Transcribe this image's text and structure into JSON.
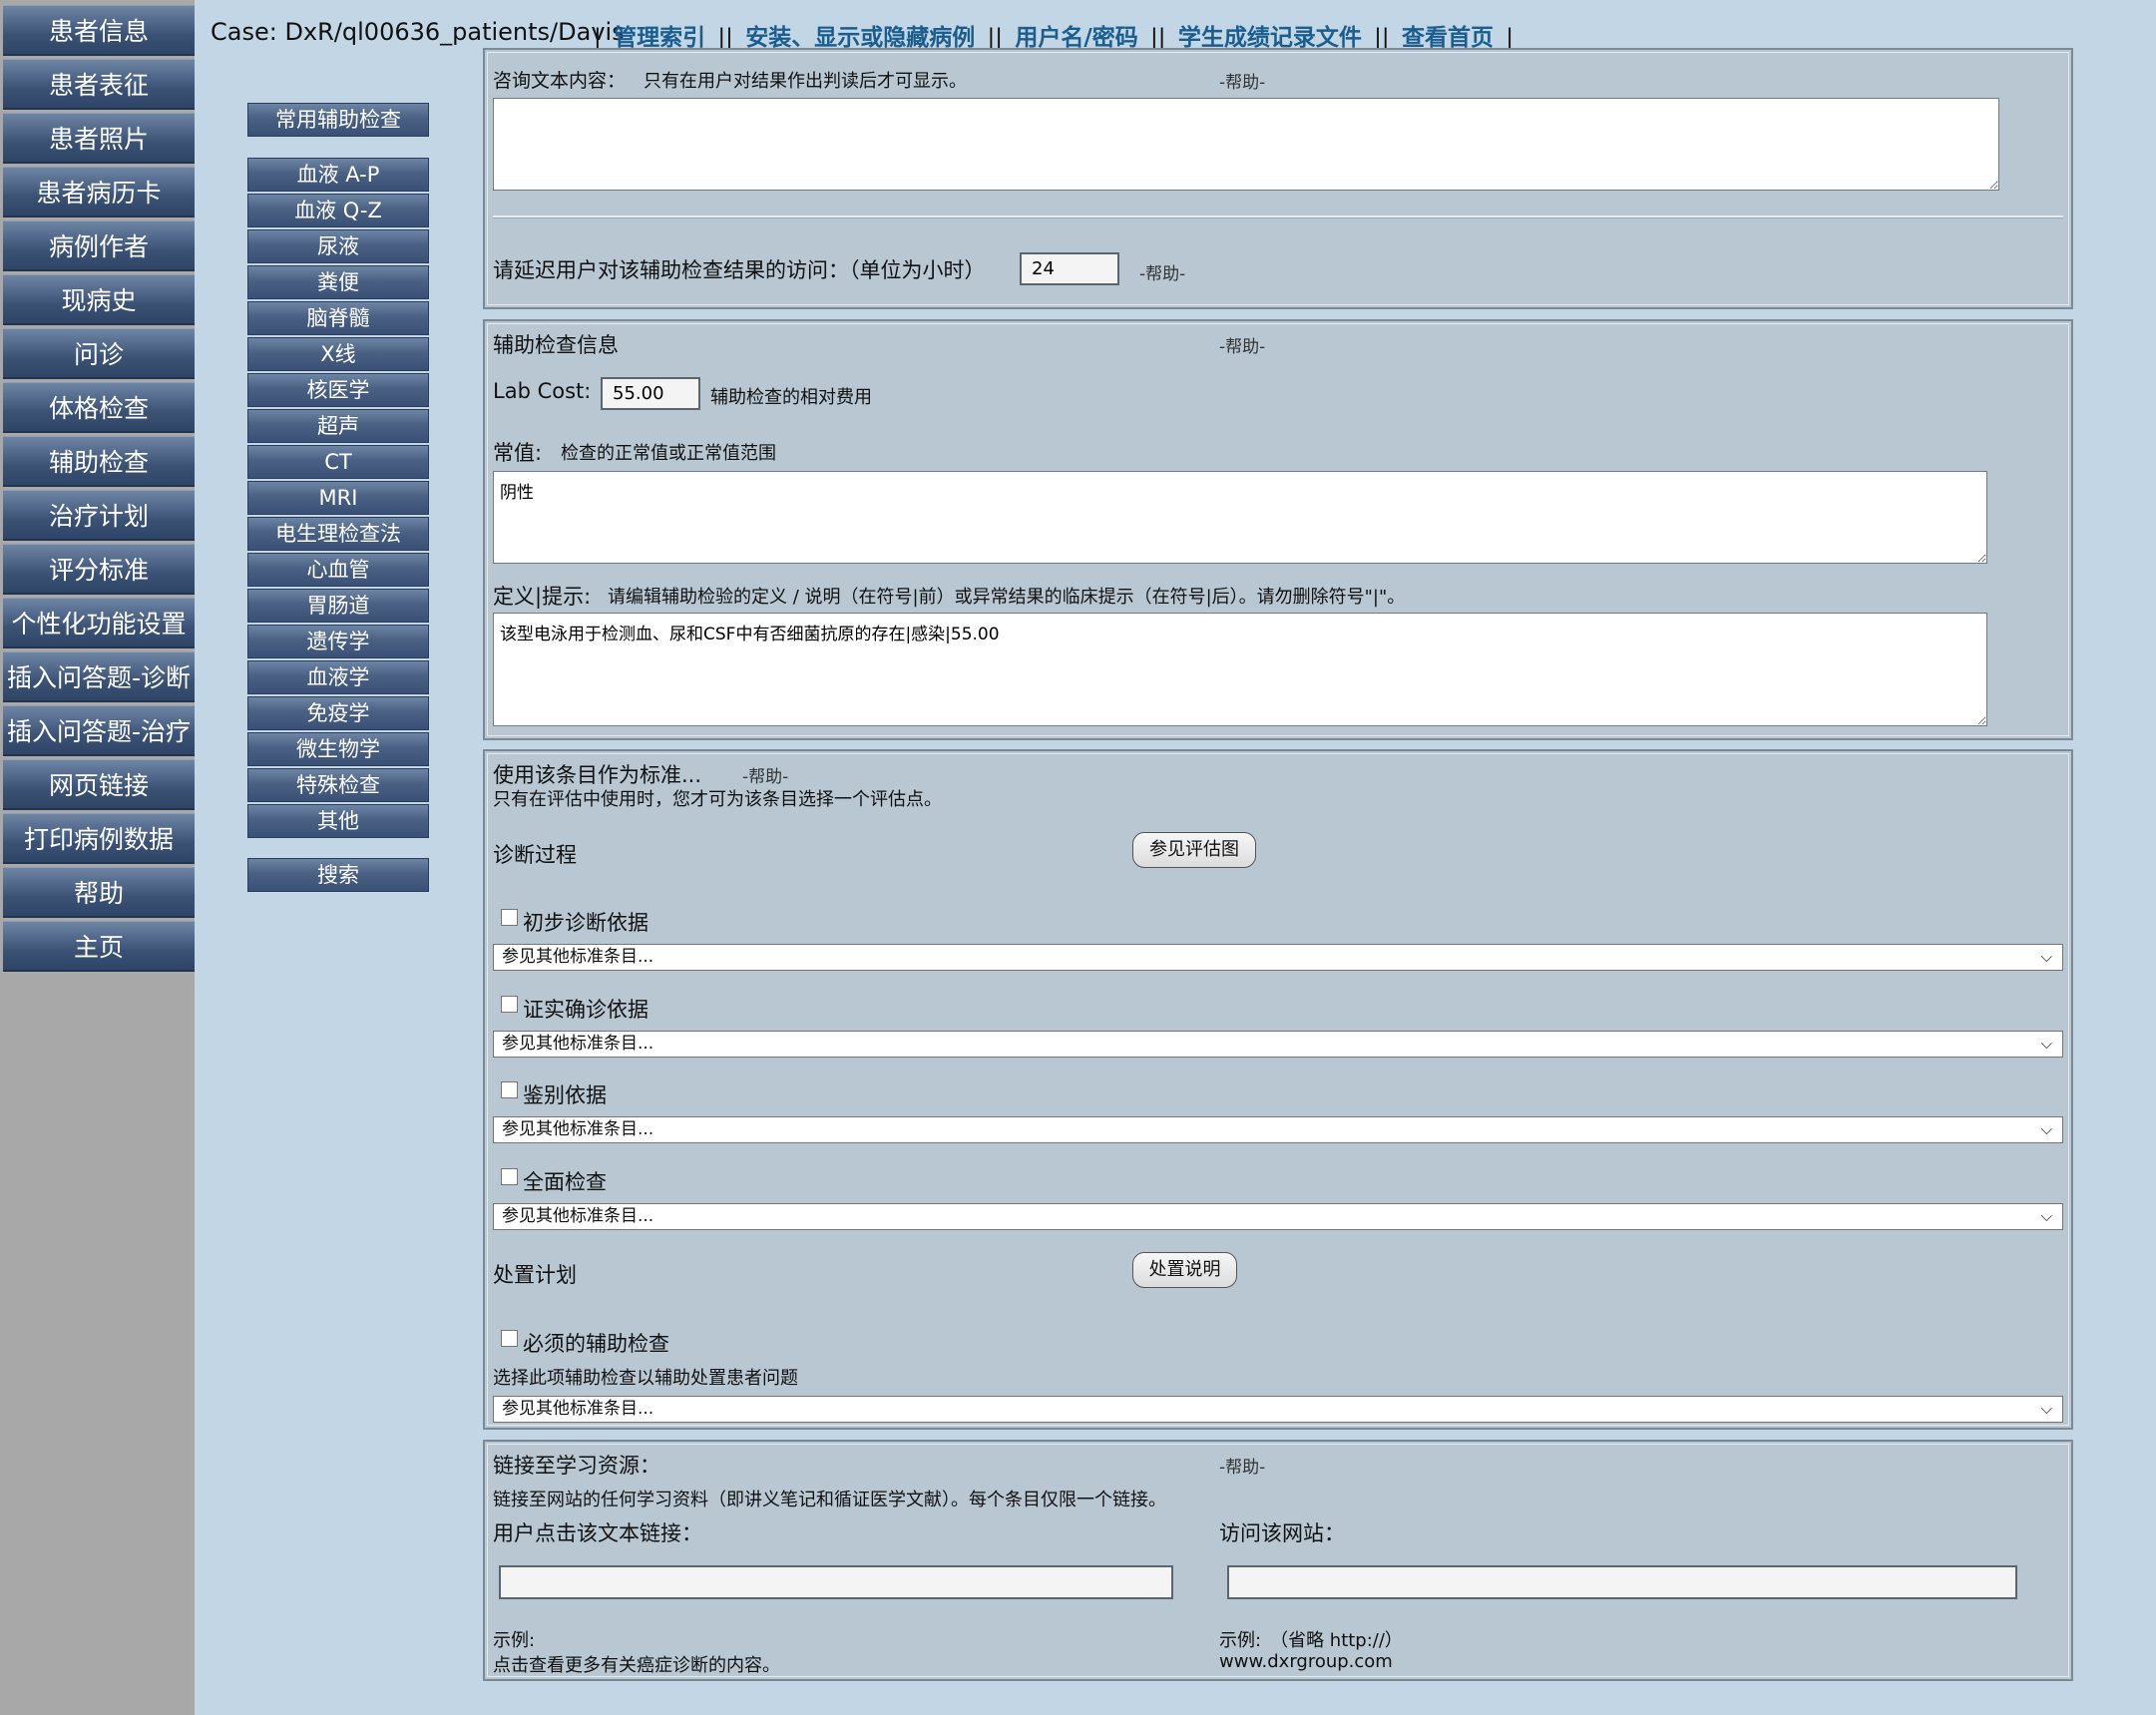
{
  "left_nav": [
    "患者信息",
    "患者表征",
    "患者照片",
    "患者病历卡",
    "病例作者",
    "现病史",
    "问诊",
    "体格检查",
    "辅助检查",
    "治疗计划",
    "评分标准",
    "个性化功能设置",
    "插入问答题-诊断",
    "插入问答题-治疗",
    "网页链接",
    "打印病例数据",
    "帮助",
    "主页"
  ],
  "header": {
    "case": "Case: DxR/ql00636_patients/Davis",
    "links": [
      "管理索引",
      "安装、显示或隐藏病例",
      "用户名/密码",
      "学生成绩记录文件",
      "查看首页"
    ],
    "sep": "||",
    "lead": "|",
    "trail": "|"
  },
  "categories": {
    "common": "常用辅助检查",
    "list": [
      "血液 A-P",
      "血液 Q-Z",
      "尿液",
      "粪便",
      "脑脊髓",
      "X线",
      "核医学",
      "超声",
      "CT",
      "MRI",
      "电生理检查法",
      "心血管",
      "胃肠道",
      "遗传学",
      "血液学",
      "免疫学",
      "微生物学",
      "特殊检查",
      "其他"
    ],
    "search": "搜索"
  },
  "help": "-帮助-",
  "consult": {
    "label": "咨询文本内容：",
    "note": "只有在用户对结果作出判读后才可显示。",
    "text": "",
    "delay_label": "请延迟用户对该辅助检查结果的访问：（单位为小时）",
    "delay_value": "24"
  },
  "lab_info": {
    "title": "辅助检查信息",
    "cost_label": "Lab Cost:",
    "cost_value": "55.00",
    "cost_note": "辅助检查的相对费用",
    "normal_label": "常值:",
    "normal_note": "检查的正常值或正常值范围",
    "normal_value": "阴性",
    "def_label": "定义|提示:",
    "def_note": "请编辑辅助检验的定义 / 说明（在符号|前）或异常结果的临床提示（在符号|后）。请勿删除符号\"|\"。",
    "def_value": "该型电泳用于检测血、尿和CSF中有否细菌抗原的存在|感染|55.00"
  },
  "standard": {
    "title": "使用该条目作为标准...",
    "note": "只有在评估中使用时，您才可为该条目选择一个评估点。",
    "diag_label": "诊断过程",
    "diag_button": "参见评估图",
    "items": [
      {
        "label": "初步诊断依据",
        "select": "参见其他标准条目..."
      },
      {
        "label": "证实确诊依据",
        "select": "参见其他标准条目..."
      },
      {
        "label": "鉴别依据",
        "select": "参见其他标准条目..."
      },
      {
        "label": "全面检查",
        "select": "参见其他标准条目..."
      }
    ],
    "plan_label": "处置计划",
    "plan_button": "处置说明",
    "required_label": "必须的辅助检查",
    "required_note": "选择此项辅助检查以辅助处置患者问题",
    "required_select": "参见其他标准条目..."
  },
  "links_panel": {
    "title": "链接至学习资源：",
    "note": "链接至网站的任何学习资料（即讲义笔记和循证医学文献）。每个条目仅限一个链接。",
    "text_label": "用户点击该文本链接：",
    "url_label": "访问该网站：",
    "text_value": "",
    "url_value": "",
    "example_label": "示例:",
    "example_text": "点击查看更多有关癌症诊断的内容。",
    "example_url_label": "示例:　（省略 http://）",
    "example_url": "www.dxrgroup.com"
  }
}
